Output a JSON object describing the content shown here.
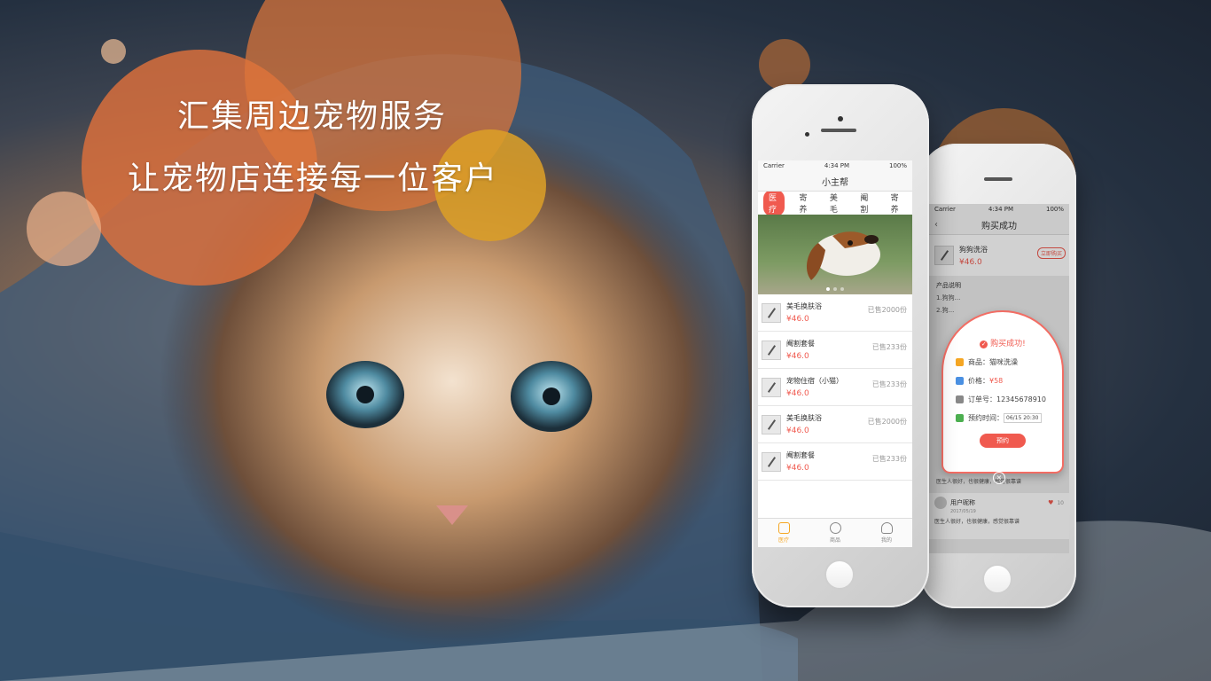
{
  "hero": {
    "line1": "汇集周边宠物服务",
    "line2": "让宠物店连接每一位客户"
  },
  "colors": {
    "accent": "#f05a4f",
    "circle_orange": "#d9743f",
    "circle_gold": "#d79b2e",
    "circle_brown": "#8f5a33",
    "tab_active": "#f5a623"
  },
  "phone1": {
    "status": {
      "carrier": "Carrier",
      "time": "4:34 PM",
      "battery": "100%"
    },
    "title": "小主帮",
    "tabs": [
      {
        "label": "医疗",
        "active": true
      },
      {
        "label": "寄养",
        "active": false
      },
      {
        "label": "美毛",
        "active": false
      },
      {
        "label": "阉割",
        "active": false
      },
      {
        "label": "寄养",
        "active": false
      }
    ],
    "items": [
      {
        "name": "美毛换肤浴",
        "price": "¥46.0",
        "sold": "已售2000份"
      },
      {
        "name": "阉割套餐",
        "price": "¥46.0",
        "sold": "已售233份"
      },
      {
        "name": "宠物住宿（小猫）",
        "price": "¥46.0",
        "sold": "已售233份"
      },
      {
        "name": "美毛换肤浴",
        "price": "¥46.0",
        "sold": "已售2000份"
      },
      {
        "name": "阉割套餐",
        "price": "¥46.0",
        "sold": "已售233份"
      }
    ],
    "tabbar": [
      {
        "label": "医疗",
        "icon": "clinic-icon",
        "active": true
      },
      {
        "label": "商品",
        "icon": "chat-icon",
        "active": false
      },
      {
        "label": "我的",
        "icon": "user-icon",
        "active": false
      }
    ]
  },
  "phone2": {
    "status": {
      "carrier": "Carrier",
      "time": "4:34 PM",
      "battery": "100%"
    },
    "title": "购买成功",
    "product": {
      "name": "狗狗洗浴",
      "price": "¥46.0",
      "buy_label": "立即购买"
    },
    "section_label": "产品说明",
    "desc_lines": [
      "1.狗狗...",
      "2.狗..."
    ],
    "popup": {
      "title": "购买成功!",
      "goods_label": "商品：",
      "goods_value": "猫咪洗澡",
      "price_label": "价格：",
      "price_value": "¥58",
      "order_label": "订单号：",
      "order_value": "12345678910",
      "time_label": "预约时间：",
      "time_value": "06/15 20:30",
      "button_label": "预约"
    },
    "comment_text": "医生人很好，也很健康，感觉很靠谱",
    "comment_user": "用户昵称",
    "comment_date": "2017/05/19",
    "comment_text2": "医生人很好，也很健康，感觉很靠谱",
    "likes": "10"
  }
}
